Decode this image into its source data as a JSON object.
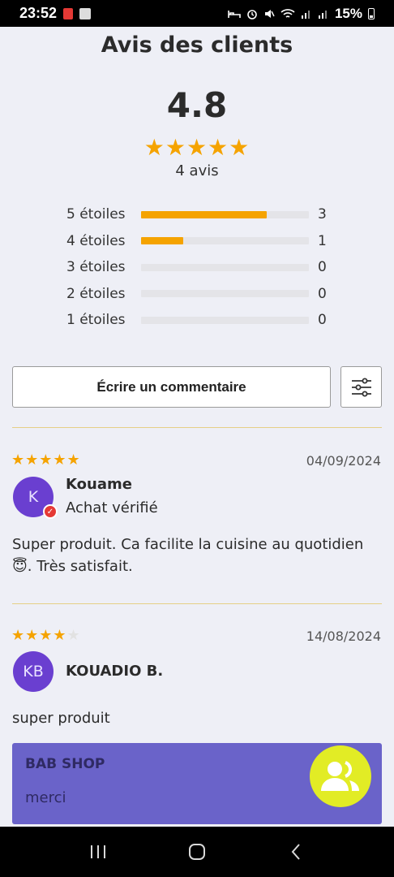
{
  "status_bar": {
    "time": "23:52",
    "battery": "15%",
    "icons": [
      "notification-red-icon",
      "document-icon",
      "bed-icon",
      "alarm-icon",
      "mute-icon",
      "wifi-icon",
      "signal-icon",
      "signal-icon",
      "battery-icon"
    ]
  },
  "title": "Avis des clients",
  "summary": {
    "average": "4.8",
    "stars": "★★★★★",
    "count_label": "4 avis"
  },
  "distribution": [
    {
      "label": "5 étoiles",
      "count": "3",
      "fraction": 0.75
    },
    {
      "label": "4 étoiles",
      "count": "1",
      "fraction": 0.25
    },
    {
      "label": "3 étoiles",
      "count": "0",
      "fraction": 0
    },
    {
      "label": "2 étoiles",
      "count": "0",
      "fraction": 0
    },
    {
      "label": "1 étoiles",
      "count": "0",
      "fraction": 0
    }
  ],
  "actions": {
    "write_label": "Écrire un commentaire",
    "filter_icon": "sliders-icon"
  },
  "reviews": [
    {
      "stars_on": "★★★★★",
      "stars_off": "",
      "date": "04/09/2024",
      "initials": "K",
      "name": "Kouame",
      "verified_label": "Achat vérifié",
      "body": "Super produit. Ca facilite la cuisine au quotidien 😇. Très satisfait."
    },
    {
      "stars_on": "★★★★",
      "stars_off": "★",
      "date": "14/08/2024",
      "initials": "KB",
      "name": "KOUADIO B.",
      "body": "super produit",
      "reply": {
        "shop": "BAB SHOP",
        "text": "merci"
      }
    }
  ],
  "colors": {
    "star": "#f5a300",
    "avatar": "#6a3fd0",
    "reply_bg": "#6a63c9",
    "chat_fab": "#e2ec25",
    "divider": "#e5cf86"
  },
  "chat_icon": "community-chat-icon"
}
